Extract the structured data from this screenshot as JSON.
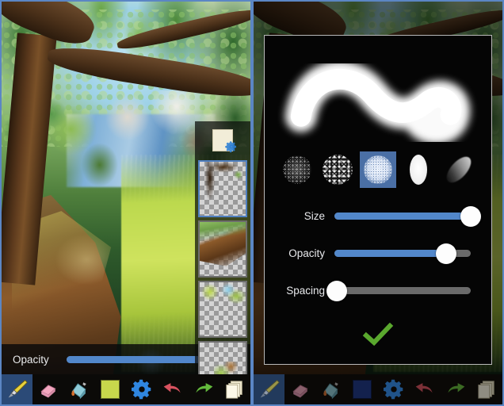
{
  "app": {
    "name": "paint-app",
    "accent_blue": "#5287ca",
    "panel_border": "#5b86c4",
    "toolbar_bg": "#0b0a08",
    "selected_tool_bg": "#2b4a77",
    "confirm_green": "#5aa82e"
  },
  "left_panel": {
    "canvas": {
      "name": "painting-canvas",
      "subject": "forest stream landscape painting"
    },
    "opacity_control": {
      "label": "Opacity",
      "value_percent": 100,
      "fill_color": "#5287ca",
      "track_color": "#6a6a6a"
    },
    "layer_panel": {
      "settings_button_label": "",
      "layers": [
        {
          "name": "layer-1",
          "selected": true
        },
        {
          "name": "layer-2",
          "selected": false
        },
        {
          "name": "layer-3",
          "selected": false
        },
        {
          "name": "layer-4",
          "selected": false
        }
      ]
    },
    "toolbar": {
      "items": [
        {
          "icon": "paintbrush-icon",
          "label": "Brush",
          "selected": true
        },
        {
          "icon": "eraser-icon",
          "label": "Eraser",
          "selected": false
        },
        {
          "icon": "paint-bucket-icon",
          "label": "Fill",
          "selected": false
        },
        {
          "icon": "color-swatch-icon",
          "label": "Color",
          "selected": false,
          "color": "#c8d84c"
        },
        {
          "icon": "gear-icon",
          "label": "Settings",
          "selected": false
        },
        {
          "icon": "undo-arrow-icon",
          "label": "Undo",
          "selected": false
        },
        {
          "icon": "redo-arrow-icon",
          "label": "Redo",
          "selected": false
        },
        {
          "icon": "layers-icon",
          "label": "Layers",
          "selected": false
        }
      ]
    }
  },
  "right_panel": {
    "dialog": {
      "name": "brush-settings-dialog",
      "stroke_preview_label": "",
      "brush_tips": [
        {
          "name": "brush-tip-soft-noise",
          "selected": false
        },
        {
          "name": "brush-tip-high-contrast-noise",
          "selected": false
        },
        {
          "name": "brush-tip-speckled-round",
          "selected": true
        },
        {
          "name": "brush-tip-solid-ellipse",
          "selected": false
        },
        {
          "name": "brush-tip-angled-ellipse",
          "selected": false
        }
      ],
      "sliders": [
        {
          "label": "Size",
          "value_percent": 100
        },
        {
          "label": "Opacity",
          "value_percent": 82
        },
        {
          "label": "Spacing",
          "value_percent": 2
        }
      ],
      "confirm_button_label": "OK"
    },
    "toolbar": {
      "dimmed": true,
      "items": [
        {
          "icon": "paintbrush-icon",
          "label": "Brush",
          "selected": true
        },
        {
          "icon": "eraser-icon",
          "label": "Eraser",
          "selected": false
        },
        {
          "icon": "paint-bucket-icon",
          "label": "Fill",
          "selected": false
        },
        {
          "icon": "color-swatch-icon",
          "label": "Color",
          "selected": false,
          "color": "#13214d"
        },
        {
          "icon": "gear-icon",
          "label": "Settings",
          "selected": false
        },
        {
          "icon": "undo-arrow-icon",
          "label": "Undo",
          "selected": false
        },
        {
          "icon": "redo-arrow-icon",
          "label": "Redo",
          "selected": false
        },
        {
          "icon": "layers-icon",
          "label": "Layers",
          "selected": false
        }
      ]
    }
  }
}
